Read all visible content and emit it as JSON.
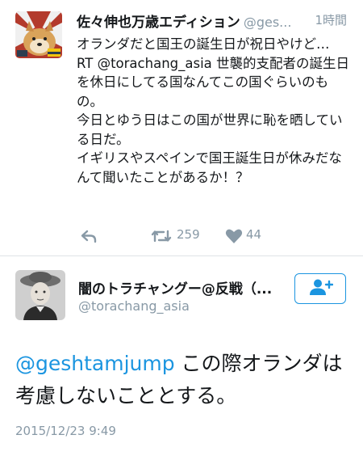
{
  "tweet1": {
    "author_name": "佐々伸也万歳エディション",
    "author_handle": "@ges...",
    "time": "1時間",
    "body_lines": [
      "オランダだと国王の誕生日が祝日やけど…",
      "RT @torachang_asia 世襲的支配者の誕生日を休日にしてる国なんてこの国ぐらいのもの。",
      "今日とゆう日はこの国が世界に恥を晒している日だ。",
      "イギリスやスペインで国王誕生日が休みだなんて聞いたことがあるか！？"
    ],
    "retweet_count": "259",
    "like_count": "44",
    "icons": {
      "reply": "reply-icon",
      "retweet": "retweet-icon",
      "like": "heart-icon"
    }
  },
  "tweet2": {
    "author_name": "闇のトラチャングー@反戦（...",
    "author_handle": "@torachang_asia",
    "mention": "@geshtamjump",
    "body_text": " この際オランダは考慮しないこととする。",
    "date": "2015/12/23 9:49",
    "follow_icon": "add-user-icon"
  },
  "colors": {
    "link_blue": "#1b95e0",
    "muted_gray": "#8899a6",
    "divider": "#dfe3e7",
    "text": "#14171a"
  }
}
